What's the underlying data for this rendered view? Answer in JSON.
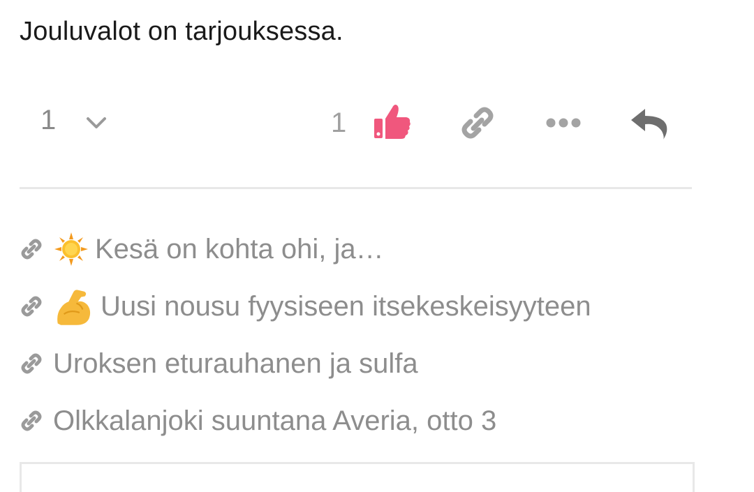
{
  "post": {
    "text": "Jouluvalot on tarjouksessa."
  },
  "actions": {
    "reply_count": "1",
    "like_count": "1",
    "icons": {
      "chevron": "chevron-down-icon",
      "like": "thumbs-up-icon",
      "link": "link-icon",
      "more": "more-icon",
      "reply": "reply-icon"
    },
    "like_color": "#f0577d"
  },
  "links": [
    {
      "icon": "sun-emoji",
      "title": "Kesä on kohta ohi, ja…"
    },
    {
      "icon": "flexed-biceps-emoji",
      "title": "Uusi nousu fyysiseen itsekeskeisyyteen"
    },
    {
      "icon": "",
      "title": "Uroksen eturauhanen ja sulfa"
    },
    {
      "icon": "",
      "title": "Olkkalanjoki suuntana Averia, otto 3"
    }
  ]
}
